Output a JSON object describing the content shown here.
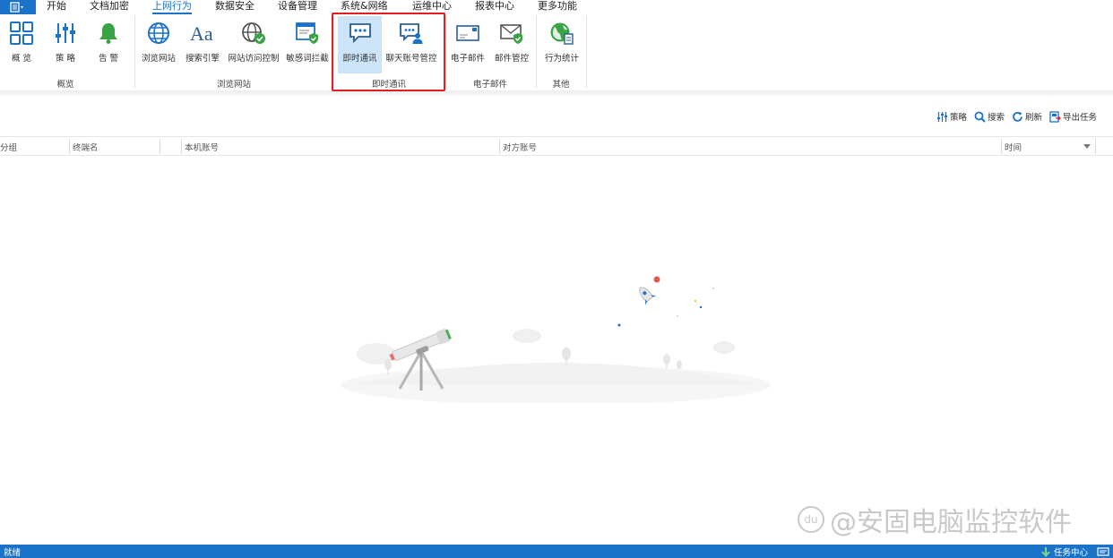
{
  "menu": {
    "tabs": [
      {
        "label": "开始"
      },
      {
        "label": "文档加密"
      },
      {
        "label": "上网行为"
      },
      {
        "label": "数据安全"
      },
      {
        "label": "设备管理"
      },
      {
        "label": "系统&网络"
      },
      {
        "label": "运维中心"
      },
      {
        "label": "报表中心"
      },
      {
        "label": "更多功能"
      }
    ],
    "active_tab": "上网行为"
  },
  "ribbon": {
    "groups": [
      {
        "label": "概览",
        "items": [
          {
            "label": "概 览",
            "icon": "overview-grid-icon"
          },
          {
            "label": "策 略",
            "icon": "policy-sliders-icon"
          },
          {
            "label": "告 警",
            "icon": "alarm-bell-icon"
          }
        ]
      },
      {
        "label": "浏览网站",
        "items": [
          {
            "label": "浏览网站",
            "icon": "globe-icon"
          },
          {
            "label": "搜索引擎",
            "icon": "font-aa-icon"
          },
          {
            "label": "网站访问控制",
            "icon": "globe-check-icon"
          },
          {
            "label": "敏感词拦截",
            "icon": "window-shield-icon"
          }
        ]
      },
      {
        "label": "即时通讯",
        "items": [
          {
            "label": "即时通讯",
            "icon": "chat-bubble-icon"
          },
          {
            "label": "聊天账号管控",
            "icon": "chat-user-icon"
          }
        ]
      },
      {
        "label": "电子邮件",
        "items": [
          {
            "label": "电子邮件",
            "icon": "envelope-icon"
          },
          {
            "label": "邮件管控",
            "icon": "envelope-shield-icon"
          }
        ]
      },
      {
        "label": "其他",
        "items": [
          {
            "label": "行为统计",
            "icon": "globe-report-icon"
          }
        ]
      }
    ],
    "selected_item": "即时通讯"
  },
  "toolbar": {
    "policy_label": "策略",
    "search_label": "搜索",
    "refresh_label": "刷新",
    "export_label": "导出任务"
  },
  "table": {
    "columns": [
      "分组",
      "终端名",
      "本机账号",
      "对方账号",
      "时间"
    ]
  },
  "watermark": {
    "text": "@安固电脑监控软件",
    "badge": "du"
  },
  "status": {
    "left": "就绪",
    "task_center": "任务中心"
  },
  "colors": {
    "accent": "#1a73c9",
    "highlight": "#e02020",
    "selected_bg": "#cce4f7"
  }
}
